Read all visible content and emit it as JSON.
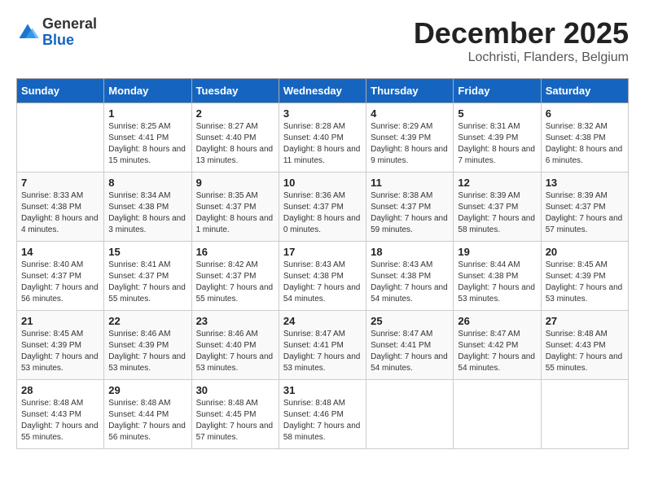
{
  "logo": {
    "general": "General",
    "blue": "Blue"
  },
  "title": "December 2025",
  "subtitle": "Lochristi, Flanders, Belgium",
  "days_of_week": [
    "Sunday",
    "Monday",
    "Tuesday",
    "Wednesday",
    "Thursday",
    "Friday",
    "Saturday"
  ],
  "weeks": [
    [
      {
        "day": "",
        "sunrise": "",
        "sunset": "",
        "daylight": ""
      },
      {
        "day": "1",
        "sunrise": "Sunrise: 8:25 AM",
        "sunset": "Sunset: 4:41 PM",
        "daylight": "Daylight: 8 hours and 15 minutes."
      },
      {
        "day": "2",
        "sunrise": "Sunrise: 8:27 AM",
        "sunset": "Sunset: 4:40 PM",
        "daylight": "Daylight: 8 hours and 13 minutes."
      },
      {
        "day": "3",
        "sunrise": "Sunrise: 8:28 AM",
        "sunset": "Sunset: 4:40 PM",
        "daylight": "Daylight: 8 hours and 11 minutes."
      },
      {
        "day": "4",
        "sunrise": "Sunrise: 8:29 AM",
        "sunset": "Sunset: 4:39 PM",
        "daylight": "Daylight: 8 hours and 9 minutes."
      },
      {
        "day": "5",
        "sunrise": "Sunrise: 8:31 AM",
        "sunset": "Sunset: 4:39 PM",
        "daylight": "Daylight: 8 hours and 7 minutes."
      },
      {
        "day": "6",
        "sunrise": "Sunrise: 8:32 AM",
        "sunset": "Sunset: 4:38 PM",
        "daylight": "Daylight: 8 hours and 6 minutes."
      }
    ],
    [
      {
        "day": "7",
        "sunrise": "Sunrise: 8:33 AM",
        "sunset": "Sunset: 4:38 PM",
        "daylight": "Daylight: 8 hours and 4 minutes."
      },
      {
        "day": "8",
        "sunrise": "Sunrise: 8:34 AM",
        "sunset": "Sunset: 4:38 PM",
        "daylight": "Daylight: 8 hours and 3 minutes."
      },
      {
        "day": "9",
        "sunrise": "Sunrise: 8:35 AM",
        "sunset": "Sunset: 4:37 PM",
        "daylight": "Daylight: 8 hours and 1 minute."
      },
      {
        "day": "10",
        "sunrise": "Sunrise: 8:36 AM",
        "sunset": "Sunset: 4:37 PM",
        "daylight": "Daylight: 8 hours and 0 minutes."
      },
      {
        "day": "11",
        "sunrise": "Sunrise: 8:38 AM",
        "sunset": "Sunset: 4:37 PM",
        "daylight": "Daylight: 7 hours and 59 minutes."
      },
      {
        "day": "12",
        "sunrise": "Sunrise: 8:39 AM",
        "sunset": "Sunset: 4:37 PM",
        "daylight": "Daylight: 7 hours and 58 minutes."
      },
      {
        "day": "13",
        "sunrise": "Sunrise: 8:39 AM",
        "sunset": "Sunset: 4:37 PM",
        "daylight": "Daylight: 7 hours and 57 minutes."
      }
    ],
    [
      {
        "day": "14",
        "sunrise": "Sunrise: 8:40 AM",
        "sunset": "Sunset: 4:37 PM",
        "daylight": "Daylight: 7 hours and 56 minutes."
      },
      {
        "day": "15",
        "sunrise": "Sunrise: 8:41 AM",
        "sunset": "Sunset: 4:37 PM",
        "daylight": "Daylight: 7 hours and 55 minutes."
      },
      {
        "day": "16",
        "sunrise": "Sunrise: 8:42 AM",
        "sunset": "Sunset: 4:37 PM",
        "daylight": "Daylight: 7 hours and 55 minutes."
      },
      {
        "day": "17",
        "sunrise": "Sunrise: 8:43 AM",
        "sunset": "Sunset: 4:38 PM",
        "daylight": "Daylight: 7 hours and 54 minutes."
      },
      {
        "day": "18",
        "sunrise": "Sunrise: 8:43 AM",
        "sunset": "Sunset: 4:38 PM",
        "daylight": "Daylight: 7 hours and 54 minutes."
      },
      {
        "day": "19",
        "sunrise": "Sunrise: 8:44 AM",
        "sunset": "Sunset: 4:38 PM",
        "daylight": "Daylight: 7 hours and 53 minutes."
      },
      {
        "day": "20",
        "sunrise": "Sunrise: 8:45 AM",
        "sunset": "Sunset: 4:39 PM",
        "daylight": "Daylight: 7 hours and 53 minutes."
      }
    ],
    [
      {
        "day": "21",
        "sunrise": "Sunrise: 8:45 AM",
        "sunset": "Sunset: 4:39 PM",
        "daylight": "Daylight: 7 hours and 53 minutes."
      },
      {
        "day": "22",
        "sunrise": "Sunrise: 8:46 AM",
        "sunset": "Sunset: 4:39 PM",
        "daylight": "Daylight: 7 hours and 53 minutes."
      },
      {
        "day": "23",
        "sunrise": "Sunrise: 8:46 AM",
        "sunset": "Sunset: 4:40 PM",
        "daylight": "Daylight: 7 hours and 53 minutes."
      },
      {
        "day": "24",
        "sunrise": "Sunrise: 8:47 AM",
        "sunset": "Sunset: 4:41 PM",
        "daylight": "Daylight: 7 hours and 53 minutes."
      },
      {
        "day": "25",
        "sunrise": "Sunrise: 8:47 AM",
        "sunset": "Sunset: 4:41 PM",
        "daylight": "Daylight: 7 hours and 54 minutes."
      },
      {
        "day": "26",
        "sunrise": "Sunrise: 8:47 AM",
        "sunset": "Sunset: 4:42 PM",
        "daylight": "Daylight: 7 hours and 54 minutes."
      },
      {
        "day": "27",
        "sunrise": "Sunrise: 8:48 AM",
        "sunset": "Sunset: 4:43 PM",
        "daylight": "Daylight: 7 hours and 55 minutes."
      }
    ],
    [
      {
        "day": "28",
        "sunrise": "Sunrise: 8:48 AM",
        "sunset": "Sunset: 4:43 PM",
        "daylight": "Daylight: 7 hours and 55 minutes."
      },
      {
        "day": "29",
        "sunrise": "Sunrise: 8:48 AM",
        "sunset": "Sunset: 4:44 PM",
        "daylight": "Daylight: 7 hours and 56 minutes."
      },
      {
        "day": "30",
        "sunrise": "Sunrise: 8:48 AM",
        "sunset": "Sunset: 4:45 PM",
        "daylight": "Daylight: 7 hours and 57 minutes."
      },
      {
        "day": "31",
        "sunrise": "Sunrise: 8:48 AM",
        "sunset": "Sunset: 4:46 PM",
        "daylight": "Daylight: 7 hours and 58 minutes."
      },
      {
        "day": "",
        "sunrise": "",
        "sunset": "",
        "daylight": ""
      },
      {
        "day": "",
        "sunrise": "",
        "sunset": "",
        "daylight": ""
      },
      {
        "day": "",
        "sunrise": "",
        "sunset": "",
        "daylight": ""
      }
    ]
  ]
}
